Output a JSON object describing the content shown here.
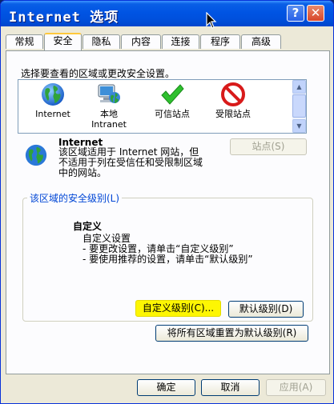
{
  "window": {
    "title": "Internet 选项"
  },
  "tabs": [
    "常规",
    "安全",
    "隐私",
    "内容",
    "连接",
    "程序",
    "高级"
  ],
  "active_tab": "安全",
  "zone_prompt": "选择要查看的区域或更改安全设置。",
  "zones": [
    {
      "label": "Internet",
      "icon": "globe-icon"
    },
    {
      "label": "本地",
      "label2": "Intranet",
      "icon": "computer-globe-icon"
    },
    {
      "label": "可信站点",
      "icon": "checkmark-icon"
    },
    {
      "label": "受限站点",
      "icon": "restricted-icon"
    }
  ],
  "selected_zone": {
    "name": "Internet",
    "desc_lines": [
      "该区域适用于 Internet 网站，但",
      "不适用于列在受信任和受限制区域",
      "中的网站。"
    ]
  },
  "sites_button": "站点(S)",
  "security_group_title": "该区域的安全级别(L)",
  "custom": {
    "title": "自定义",
    "lines": [
      "自定义设置",
      "- 要更改设置，请单击“自定义级别”",
      "- 要使用推荐的设置，请单击“默认级别”"
    ]
  },
  "buttons": {
    "custom_level": "自定义级别(C)...",
    "default_level": "默认级别(D)",
    "reset_all": "将所有区域重置为默认级别(R)",
    "ok": "确定",
    "cancel": "取消",
    "apply": "应用(A)"
  },
  "colors": {
    "title_bar": "#0054e3",
    "highlight": "#fdf603",
    "dialog_bg": "#ece9d8"
  }
}
